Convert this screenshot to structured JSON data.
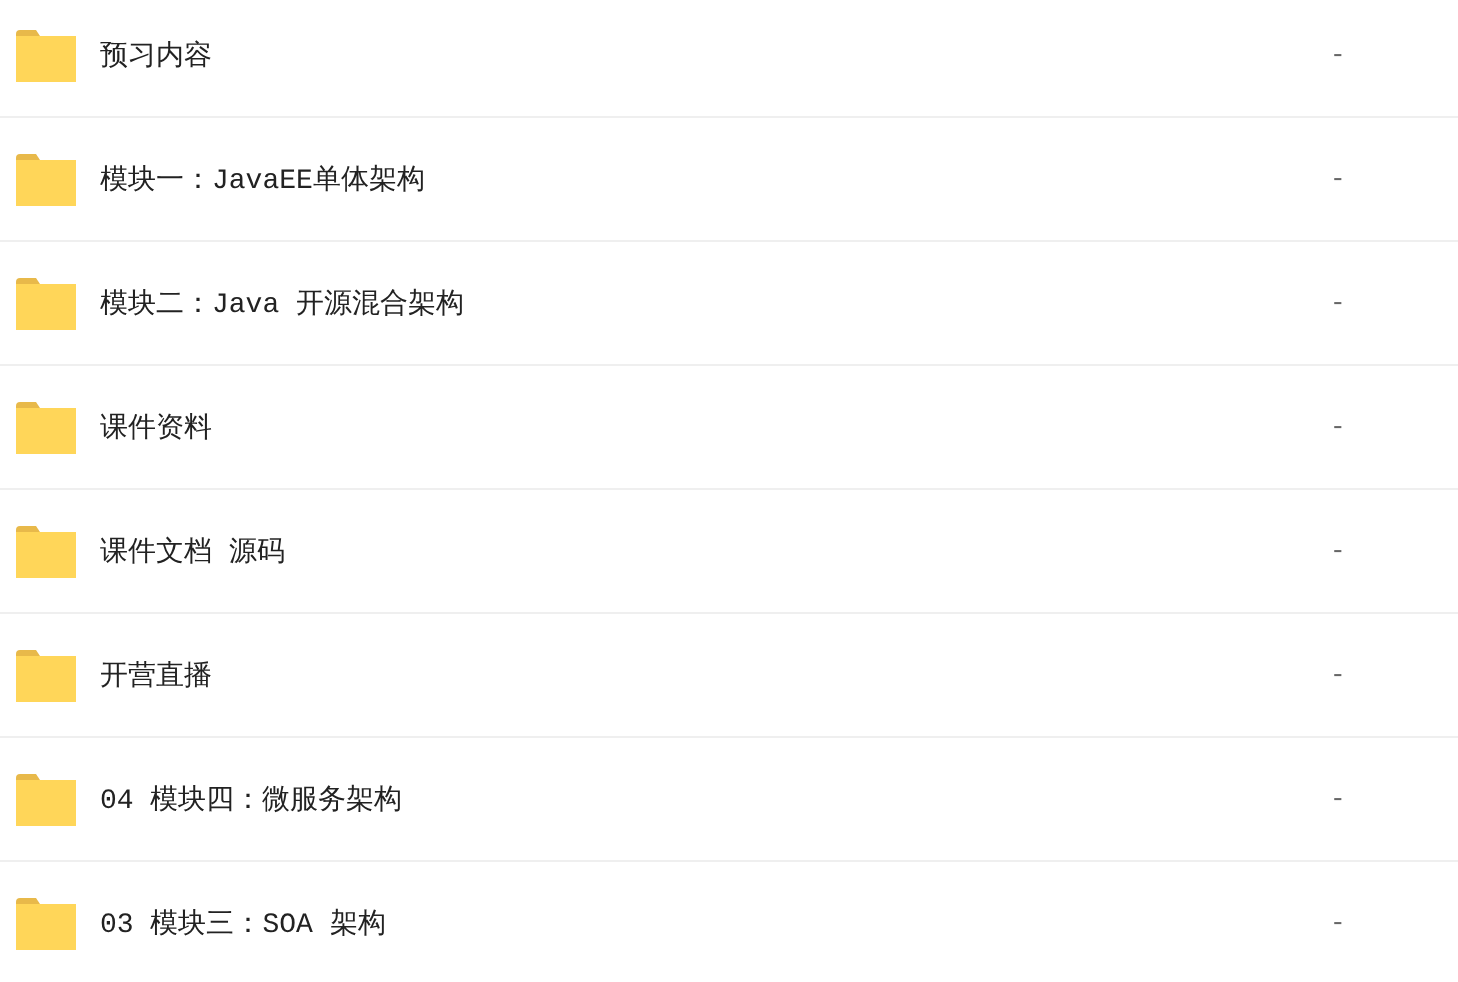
{
  "files": [
    {
      "name": "预习内容",
      "size": "-"
    },
    {
      "name": "模块一：JavaEE单体架构",
      "size": "-"
    },
    {
      "name": "模块二：Java 开源混合架构",
      "size": "-"
    },
    {
      "name": "课件资料",
      "size": "-"
    },
    {
      "name": "课件文档 源码",
      "size": "-"
    },
    {
      "name": "开营直播",
      "size": "-"
    },
    {
      "name": "04 模块四：微服务架构",
      "size": "-"
    },
    {
      "name": "03 模块三：SOA 架构",
      "size": "-"
    }
  ]
}
